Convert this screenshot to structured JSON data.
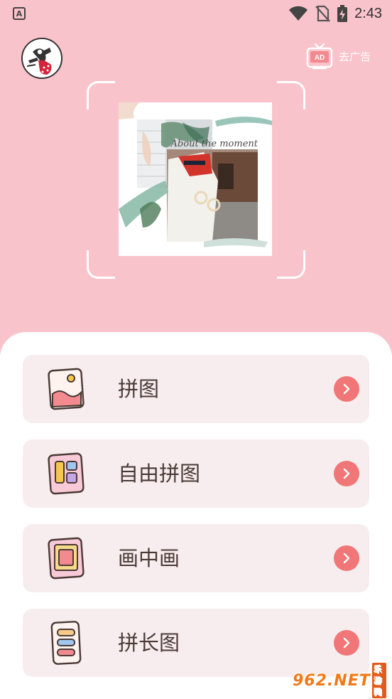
{
  "status_bar": {
    "notification_letter": "A",
    "time": "2:43"
  },
  "header": {
    "ad_badge_text": "AD",
    "remove_ads_label": "去广告"
  },
  "preview": {
    "script_caption": "About the moment"
  },
  "menu": {
    "items": [
      {
        "label": "拼图",
        "icon": "photo-puzzle-icon"
      },
      {
        "label": "自由拼图",
        "icon": "free-layout-icon"
      },
      {
        "label": "画中画",
        "icon": "picture-in-picture-icon"
      },
      {
        "label": "拼长图",
        "icon": "long-image-icon"
      }
    ]
  },
  "watermark": {
    "brand": "962.NET",
    "sub": "乐游网"
  },
  "colors": {
    "background": "#f9c3cb",
    "card": "#f7edee",
    "accent": "#f07677"
  }
}
